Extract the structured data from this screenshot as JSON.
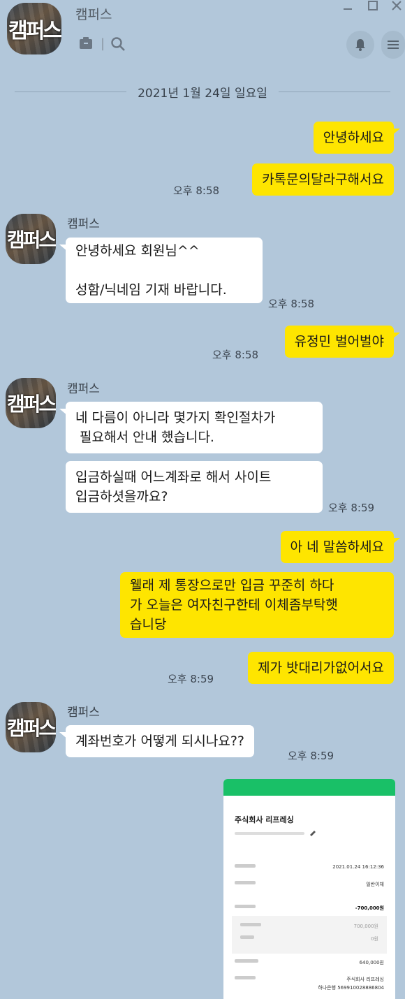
{
  "window": {
    "title": "캠퍼스",
    "avatar_text": "캠퍼스"
  },
  "date_separator": "2021년 1월 24일 일요일",
  "messages": [
    {
      "text": "안녕하세요"
    },
    {
      "text": "카톡문의달라구해서요",
      "time": "오후 8:58"
    },
    {
      "sender": "캠퍼스",
      "text": "안녕하세요 회원님^^\n\n성함/닉네임 기재 바랍니다.",
      "time": "오후 8:58"
    },
    {
      "text": "유정민 벌어벌야",
      "time": "오후 8:58"
    },
    {
      "sender": "캠퍼스",
      "text": "네 다름이 아니라 몇가지 확인절차가\n 필요해서 안내 했습니다."
    },
    {
      "text": "입금하실때 어느계좌로 해서 사이트\n입금하셧을까요?",
      "time": "오후 8:59"
    },
    {
      "text": "아 네 말씀하세요"
    },
    {
      "text": "웰래 제 통장으로만 입금 꾸준히 하다\n가 오늘은 여자친구한테 이체좀부탁햇\n습니당"
    },
    {
      "text": "제가 밧대리가없어서요",
      "time": "오후 8:59"
    },
    {
      "sender": "캠퍼스",
      "text": "계좌번호가 어떻게 되시나요??",
      "time": "오후 8:59"
    }
  ],
  "receipt": {
    "company": "주식회사 리프레싱",
    "date_value": "2021.01.24 16:12:36",
    "method_value": "일반이체",
    "amount_value": "-700,000원",
    "transfer_value": "700,000원",
    "fee_value": "0원",
    "balance_value": "640,000원",
    "account_value_1": "주식회사 리프레싱",
    "account_value_2": "하나은행 569910028886804"
  },
  "colors": {
    "background": "#b2c7da",
    "my_bubble": "#fee500",
    "other_bubble": "#ffffff",
    "receipt_bar": "#19c067"
  }
}
